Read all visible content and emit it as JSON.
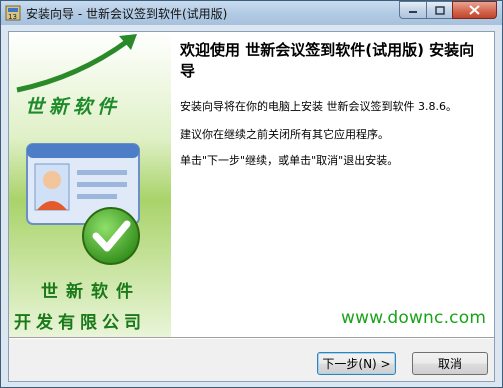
{
  "window": {
    "title": "安装向导 - 世新会议签到软件(试用版)"
  },
  "banner": {
    "slogan": "世新软件",
    "company_line1": "世新软件",
    "company_line2": "开发有限公司"
  },
  "main": {
    "heading": "欢迎使用 世新会议签到软件(试用版) 安装向导",
    "para1": "安装向导将在你的电脑上安装 世新会议签到软件 3.8.6。",
    "para2": "建议你在继续之前关闭所有其它应用程序。",
    "para3": "单击\"下一步\"继续，或单击\"取消\"退出安装。"
  },
  "watermark": "www.downc.com",
  "buttons": {
    "next": "下一步(N) >",
    "cancel": "取消"
  },
  "colors": {
    "banner_green": "#6cae2a",
    "slogan_green": "#1f8a2a",
    "watermark": "#1aa31a"
  }
}
